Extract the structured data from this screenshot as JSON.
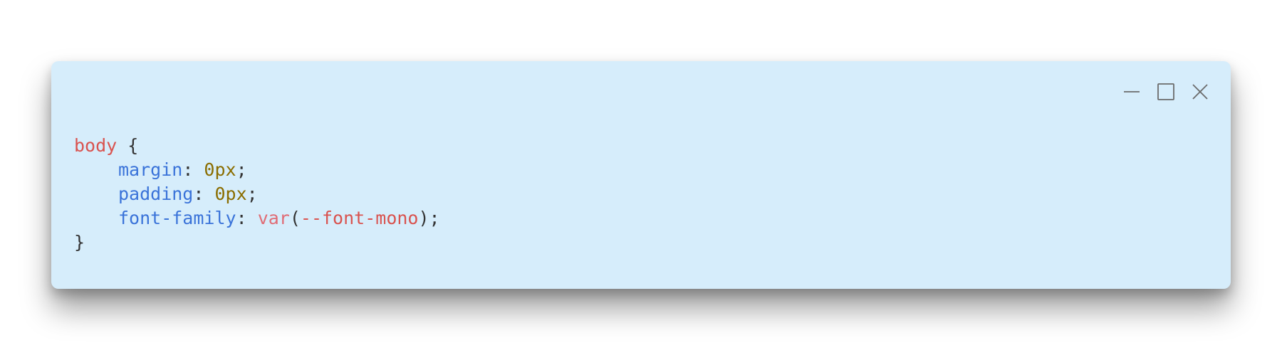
{
  "window": {
    "controls": {
      "minimize": "minimize-icon",
      "maximize": "maximize-icon",
      "close": "close-icon"
    }
  },
  "code": {
    "selector": "body",
    "open_brace": "{",
    "close_brace": "}",
    "declarations": [
      {
        "property": "margin",
        "colon": ": ",
        "value": "0px",
        "semicolon": ";"
      },
      {
        "property": "padding",
        "colon": ": ",
        "value": "0px",
        "semicolon": ";"
      },
      {
        "property": "font-family",
        "colon": ": ",
        "func": "var",
        "paren_open": "(",
        "arg": "--font-mono",
        "paren_close": ")",
        "semicolon": ";"
      }
    ]
  },
  "colors": {
    "window_bg": "#d6edfb",
    "selector": "#d9534f",
    "property": "#3a73d9",
    "number": "#8a6d00",
    "function": "#d9534f",
    "punctuation": "#333333"
  }
}
